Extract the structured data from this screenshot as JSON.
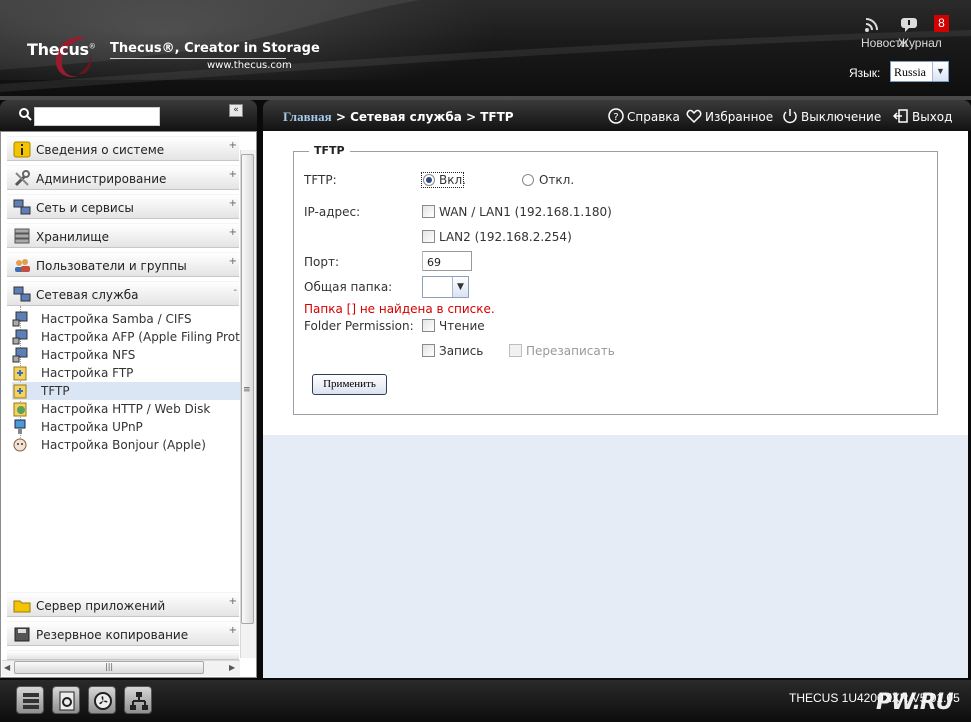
{
  "header": {
    "logo_text": "Thecus",
    "tagline": "Thecus®, Creator in Storage",
    "url": "www.thecus.com",
    "news_label": "Новости",
    "journal_label": "Журнал",
    "journal_badge": "8",
    "language_label": "Язык:",
    "language_value": "Russia"
  },
  "search": {
    "placeholder": "",
    "collapse_glyph": "«"
  },
  "breadcrumb": {
    "home": "Главная",
    "path": " > Сетевая служба > TFTP"
  },
  "toplinks": {
    "help": "Справка",
    "favorites": "Избранное",
    "shutdown": "Выключение",
    "logout": "Выход"
  },
  "sidebar": {
    "categories": [
      {
        "label": "Сведения о системе",
        "icon": "info-icon"
      },
      {
        "label": "Администрирование",
        "icon": "tools-icon"
      },
      {
        "label": "Сеть и сервисы",
        "icon": "network-icon"
      },
      {
        "label": "Хранилище",
        "icon": "storage-icon"
      },
      {
        "label": "Пользователи и группы",
        "icon": "users-icon"
      },
      {
        "label": "Сетевая служба",
        "icon": "network-service-icon"
      }
    ],
    "subitems": [
      {
        "label": "Настройка Samba / CIFS"
      },
      {
        "label": "Настройка AFP (Apple Filing Protocol)"
      },
      {
        "label": "Настройка NFS"
      },
      {
        "label": "Настройка FTP"
      },
      {
        "label": "TFTP"
      },
      {
        "label": "Настройка HTTP / Web Disk"
      },
      {
        "label": "Настройка UPnP"
      },
      {
        "label": "Настройка Bonjour (Apple)"
      }
    ],
    "bottom_categories": [
      {
        "label": "Сервер приложений",
        "icon": "folder-icon"
      },
      {
        "label": "Резервное копирование",
        "icon": "backup-icon"
      }
    ],
    "plus": "+",
    "minus": "-"
  },
  "form": {
    "legend": "TFTP",
    "tftp_label": "TFTP:",
    "on_label": "Вкл.",
    "off_label": "Откл.",
    "ip_label": "IP-адрес:",
    "wan_label": "WAN / LAN1 (192.168.1.180)",
    "lan2_label": "LAN2 (192.168.2.254)",
    "port_label": "Порт:",
    "port_value": "69",
    "share_label": "Общая папка:",
    "error": "Папка [] не найдена в списке.",
    "perm_label": "Folder Permission:",
    "read_label": "Чтение",
    "write_label": "Запись",
    "overwrite_label": "Перезаписать",
    "apply_label": "Применить"
  },
  "footer": {
    "model": "THECUS 1U4200XXR V5.01.05",
    "watermark": "PW.RU"
  }
}
